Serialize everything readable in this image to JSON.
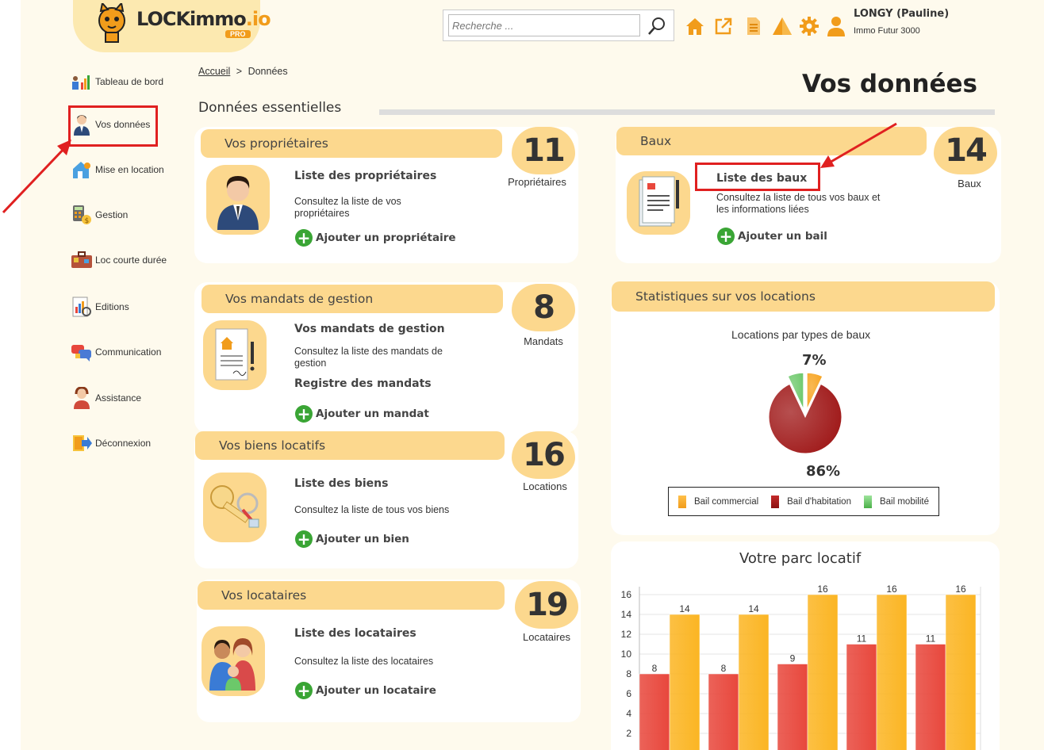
{
  "header": {
    "logo_text": "LOCKimmo",
    "logo_suffix": ".io",
    "logo_badge": "PRO",
    "search_placeholder": "Recherche ...",
    "user_name": "LONGY (Pauline)",
    "user_company": "Immo Futur 3000",
    "icons": [
      "home-icon",
      "external-link-icon",
      "document-icon",
      "alert-icon",
      "settings-gear-icon",
      "user-icon"
    ],
    "accent_color": "#f19c1b"
  },
  "sidebar": {
    "items": [
      {
        "label": "Tableau de bord",
        "icon": "dashboard-chart-icon"
      },
      {
        "label": "Vos données",
        "icon": "person-icon"
      },
      {
        "label": "Mise en location",
        "icon": "house-key-icon"
      },
      {
        "label": "Gestion",
        "icon": "calculator-icon"
      },
      {
        "label": "Loc courte durée",
        "icon": "suitcase-icon"
      },
      {
        "label": "Editions",
        "icon": "report-icon"
      },
      {
        "label": "Communication",
        "icon": "chat-bubbles-icon"
      },
      {
        "label": "Assistance",
        "icon": "headset-icon"
      },
      {
        "label": "Déconnexion",
        "icon": "logout-icon"
      }
    ]
  },
  "breadcrumb": {
    "home": "Accueil",
    "separator": ">",
    "current": "Données"
  },
  "page_title": "Vos données",
  "section_title": "Données essentielles",
  "cards": {
    "proprietaires": {
      "title": "Vos propriétaires",
      "count": "11",
      "count_label": "Propriétaires",
      "link": "Liste des propriétaires",
      "desc": "Consultez la liste de vos propriétaires",
      "add": "Ajouter un propriétaire"
    },
    "baux": {
      "title": "Baux",
      "count": "14",
      "count_label": "Baux",
      "link": "Liste des baux",
      "desc": "Consultez la liste de tous vos baux et les informations liées",
      "add": "Ajouter un bail"
    },
    "mandats": {
      "title": "Vos mandats de gestion",
      "count": "8",
      "count_label": "Mandats",
      "link": "Vos mandats de gestion",
      "desc": "Consultez la liste des mandats de gestion",
      "link2": "Registre des mandats",
      "add": "Ajouter un mandat"
    },
    "biens": {
      "title": "Vos biens locatifs",
      "count": "16",
      "count_label": "Locations",
      "link": "Liste des biens",
      "desc": "Consultez la liste de tous vos biens",
      "add": "Ajouter un bien"
    },
    "locataires": {
      "title": "Vos locataires",
      "count": "19",
      "count_label": "Locataires",
      "link": "Liste des locataires",
      "desc": "Consultez la liste des locataires",
      "add": "Ajouter un locataire"
    }
  },
  "stats": {
    "title": "Statistiques sur vos locations"
  },
  "chart_data": [
    {
      "type": "pie",
      "title": "Locations par types de baux",
      "labels": [
        "Bail commercial",
        "Bail d'habitation",
        "Bail mobilité"
      ],
      "values": [
        7,
        86,
        7
      ],
      "colors": [
        "#f7a21b",
        "#9e1515",
        "#6cc86a"
      ],
      "data_labels": [
        "7%",
        "86%"
      ],
      "legend": "bottom"
    },
    {
      "type": "bar",
      "title": "Votre parc locatif",
      "categories": [
        "",
        "",
        "",
        "",
        ""
      ],
      "series": [
        {
          "values": [
            8,
            8,
            9,
            11,
            11
          ],
          "color": "#e8473c"
        },
        {
          "values": [
            14,
            14,
            16,
            16,
            16
          ],
          "color": "#fbb523"
        }
      ],
      "yticks": [
        2,
        4,
        6,
        8,
        10,
        12,
        14,
        16
      ],
      "ylim": [
        0,
        16
      ],
      "grid": true
    }
  ]
}
